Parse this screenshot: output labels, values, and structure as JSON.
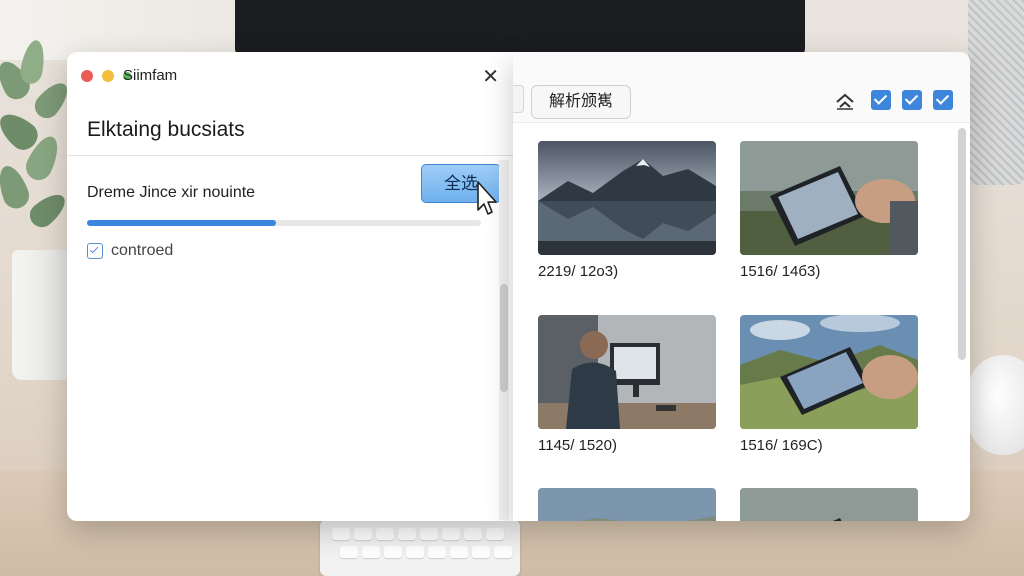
{
  "dialog": {
    "title": "Siimfam",
    "close_glyph": "✕",
    "heading": "Elktaing bucsiats",
    "description": "Dreme Jince xir nouinte",
    "select_all_label": "全选",
    "progress_fraction": 0.48,
    "checkbox_label": "controed"
  },
  "panel": {
    "analyze_label": "解析颁嶲",
    "toolbar_icons": [
      "share-icon",
      "checkbox-checked",
      "checkbox-checked",
      "checkbox-checked"
    ],
    "images": [
      {
        "scene": "mountain-lake",
        "caption": "2219/ 12о3)"
      },
      {
        "scene": "tablet-hand",
        "caption": "1516/ 14б3)"
      },
      {
        "scene": "man-at-computer",
        "caption": "1145/ 1520)"
      },
      {
        "scene": "tablet-landscape",
        "caption": "1516/ 169C)"
      },
      {
        "scene": "tablet-hand",
        "caption": ""
      },
      {
        "scene": "tablet-hand",
        "caption": ""
      }
    ]
  },
  "colors": {
    "accent": "#3e86dc",
    "close_dot": "#ec5a55",
    "minimize_dot": "#f3bd3d"
  }
}
